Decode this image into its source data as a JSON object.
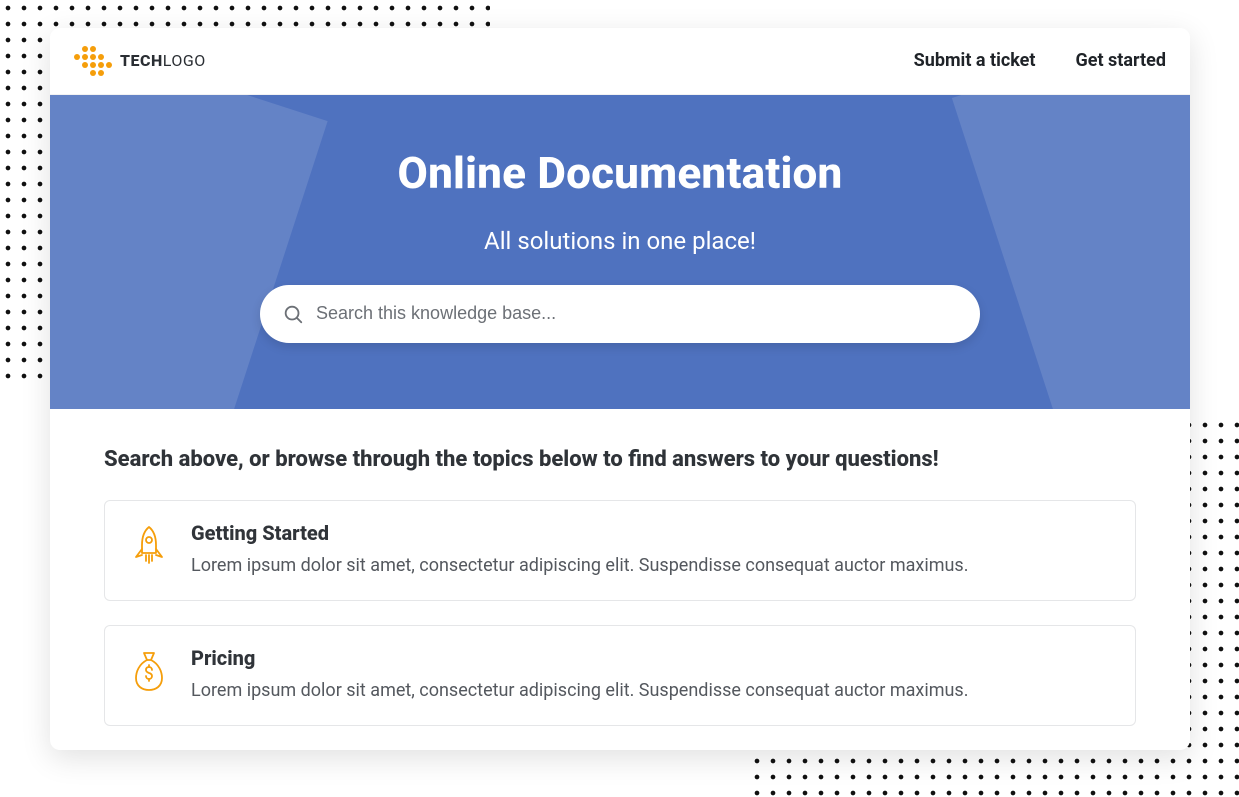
{
  "header": {
    "logo_text_bold": "TECH",
    "logo_text_thin": "LOGO",
    "nav": {
      "submit_ticket": "Submit a ticket",
      "get_started": "Get started"
    }
  },
  "hero": {
    "title": "Online Documentation",
    "subtitle": "All solutions in one place!",
    "search_placeholder": "Search this knowledge base..."
  },
  "main": {
    "heading": "Search above, or browse through the topics below to find answers to your questions!",
    "topics": [
      {
        "title": "Getting Started",
        "desc": "Lorem ipsum dolor sit amet, consectetur adipiscing elit. Suspendisse consequat auctor maximus."
      },
      {
        "title": "Pricing",
        "desc": "Lorem ipsum dolor sit amet, consectetur adipiscing elit. Suspendisse consequat auctor maximus."
      }
    ]
  },
  "colors": {
    "accent": "#f59e0b",
    "hero_bg": "#4f72bf"
  }
}
